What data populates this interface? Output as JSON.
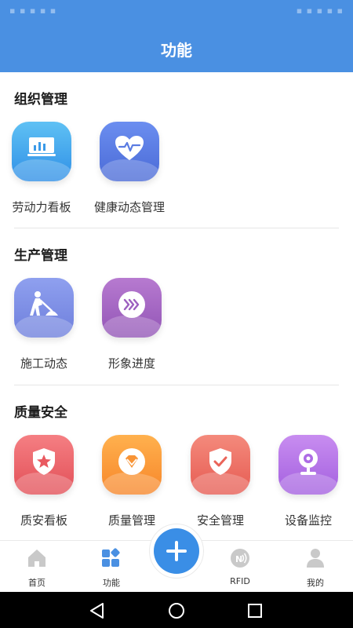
{
  "header": {
    "title": "功能"
  },
  "sections": [
    {
      "title": "组织管理",
      "items": [
        {
          "label": "劳动力看板",
          "icon": "chart-board-icon",
          "color_top": "#5fc1f4",
          "color_bottom": "#2f8fe6"
        },
        {
          "label": "健康动态管理",
          "icon": "heartbeat-icon",
          "color_top": "#6b8ef0",
          "color_bottom": "#4a6ad6"
        }
      ]
    },
    {
      "title": "生产管理",
      "items": [
        {
          "label": "施工动态",
          "icon": "construction-worker-icon",
          "color_top": "#8fa0ef",
          "color_bottom": "#6e7fdc"
        },
        {
          "label": "形象进度",
          "icon": "fast-forward-icon",
          "color_top": "#b77ad0",
          "color_bottom": "#9255b6"
        }
      ]
    },
    {
      "title": "质量安全",
      "items": [
        {
          "label": "质安看板",
          "icon": "shield-star-icon",
          "color_top": "#f57f83",
          "color_bottom": "#e24f57"
        },
        {
          "label": "质量管理",
          "icon": "diamond-badge-icon",
          "color_top": "#ffb14e",
          "color_bottom": "#f7862a"
        },
        {
          "label": "安全管理",
          "icon": "shield-check-icon",
          "color_top": "#f48a7c",
          "color_bottom": "#e65b52"
        },
        {
          "label": "设备监控",
          "icon": "webcam-icon",
          "color_top": "#c88df0",
          "color_bottom": "#a35fdf"
        }
      ]
    }
  ],
  "bottom_nav": [
    {
      "label": "首页",
      "icon": "home-icon"
    },
    {
      "label": "功能",
      "icon": "apps-grid-icon"
    },
    {
      "label": "",
      "icon": "plus-icon"
    },
    {
      "label": "RFID",
      "icon": "rfid-icon"
    },
    {
      "label": "我的",
      "icon": "user-icon"
    }
  ],
  "colors": {
    "header": "#4a90e2",
    "fab": "#3a8ee6",
    "active_nav": "#4a90e2",
    "inactive_nav": "#c9c9c9"
  }
}
